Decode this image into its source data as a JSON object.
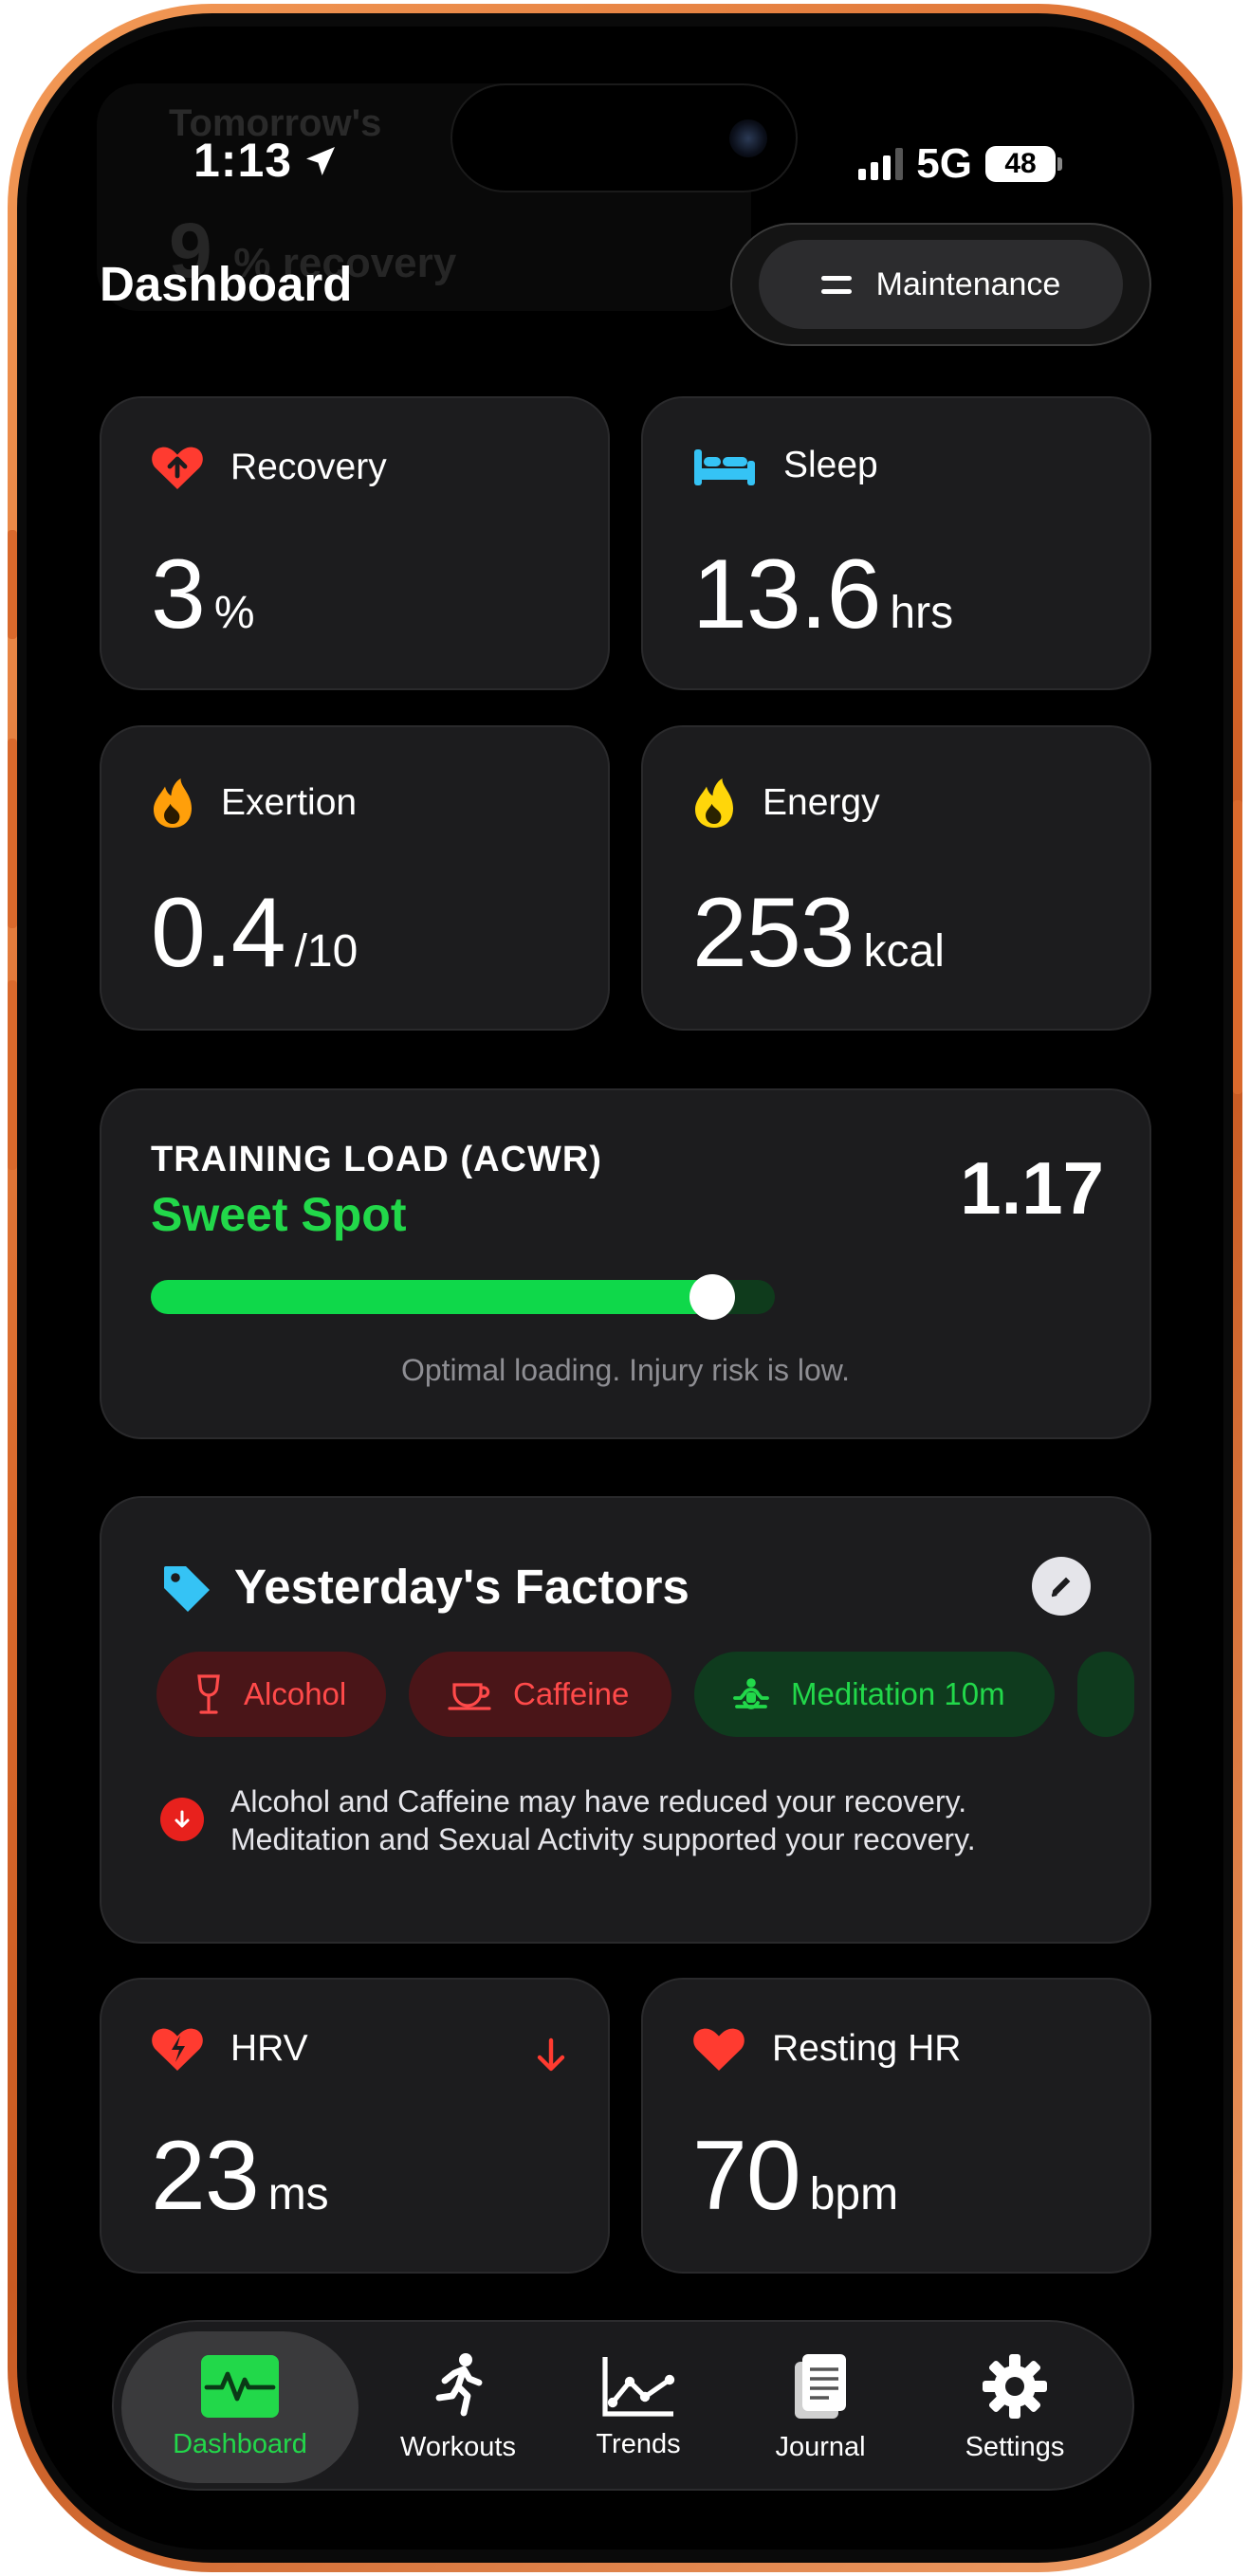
{
  "status_bar": {
    "time": "1:13",
    "network": "5G",
    "battery": "48"
  },
  "background_peek": {
    "title": "Tomorrow's",
    "value": "9",
    "label": "% recovery"
  },
  "header": {
    "title": "Dashboard",
    "mode_label": "Maintenance"
  },
  "metrics": {
    "recovery": {
      "label": "Recovery",
      "value": "3",
      "unit": "%"
    },
    "sleep": {
      "label": "Sleep",
      "value": "13.6",
      "unit": "hrs"
    },
    "exertion": {
      "label": "Exertion",
      "value": "0.4",
      "unit": "/10"
    },
    "energy": {
      "label": "Energy",
      "value": "253",
      "unit": "kcal"
    },
    "hrv": {
      "label": "HRV",
      "value": "23",
      "unit": "ms"
    },
    "resting_hr": {
      "label": "Resting HR",
      "value": "70",
      "unit": "bpm"
    }
  },
  "training_load": {
    "label": "TRAINING LOAD (ACWR)",
    "status": "Sweet Spot",
    "value": "1.17",
    "progress_fraction": 0.9,
    "note": "Optimal loading. Injury risk is low."
  },
  "factors": {
    "title": "Yesterday's Factors",
    "chips": [
      {
        "label": "Alcohol",
        "icon": "wine-glass-icon",
        "kind": "negative"
      },
      {
        "label": "Caffeine",
        "icon": "coffee-cup-icon",
        "kind": "negative"
      },
      {
        "label": "Meditation 10m",
        "icon": "meditation-icon",
        "kind": "positive"
      }
    ],
    "summary_line1": "Alcohol and Caffeine may have reduced your recovery.",
    "summary_line2": "Meditation and Sexual Activity supported your recovery."
  },
  "tabs": [
    {
      "label": "Dashboard",
      "icon": "pulse-icon",
      "active": true
    },
    {
      "label": "Workouts",
      "icon": "running-figure-icon",
      "active": false
    },
    {
      "label": "Trends",
      "icon": "line-chart-icon",
      "active": false
    },
    {
      "label": "Journal",
      "icon": "journal-icon",
      "active": false
    },
    {
      "label": "Settings",
      "icon": "gear-icon",
      "active": false
    }
  ],
  "colors": {
    "frame": "#d9692c",
    "accent_green": "#22d84a",
    "negative_red": "#ff4a4a",
    "sleep_blue": "#35c3f5",
    "energy_yellow": "#ffd60a",
    "exertion_orange": "#ff9f0a",
    "card_bg": "#1c1c1e"
  }
}
